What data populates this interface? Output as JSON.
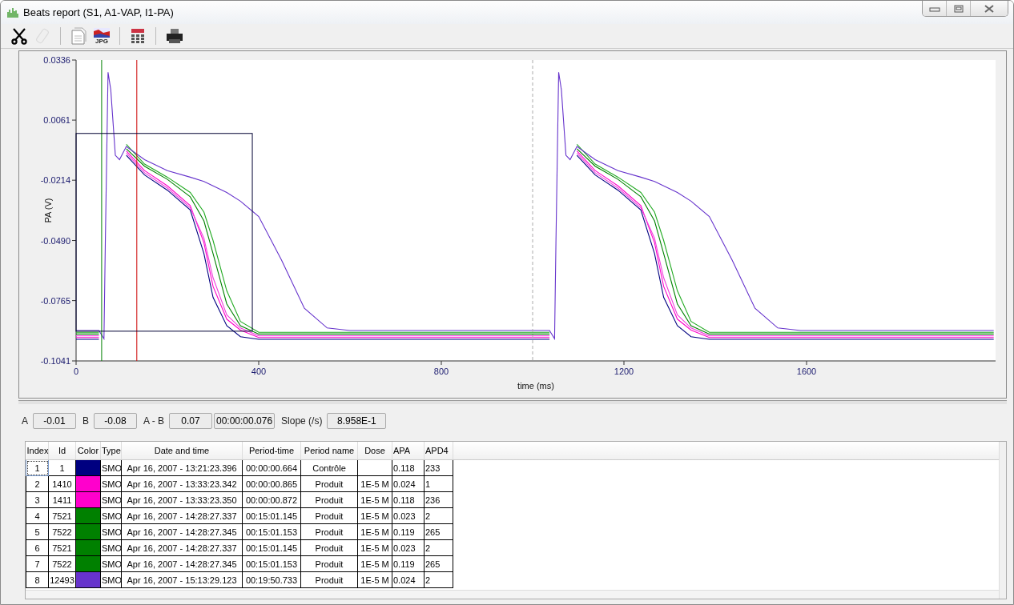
{
  "window": {
    "title": "Beats report (S1, A1-VAP, I1-PA)"
  },
  "toolbar": [
    {
      "kind": "scissors",
      "disabled": false
    },
    {
      "kind": "eraser",
      "disabled": true
    },
    {
      "kind": "separator"
    },
    {
      "kind": "document",
      "disabled": false
    },
    {
      "kind": "jpg",
      "label": "JPG",
      "disabled": false
    },
    {
      "kind": "separator"
    },
    {
      "kind": "table",
      "disabled": false
    },
    {
      "kind": "separator"
    },
    {
      "kind": "printer",
      "disabled": false
    }
  ],
  "chart": {
    "chart_data": {
      "type": "line",
      "xlabel": "time (ms)",
      "ylabel": "PA (V)",
      "xlim": [
        0,
        2014
      ],
      "ylim": [
        -0.1041,
        0.0336
      ],
      "xticks": [
        0,
        400,
        800,
        1200,
        1600
      ],
      "yticks": [
        {
          "value": 0.0336,
          "label": "0.0336"
        },
        {
          "value": 0.0061,
          "label": "0.0061"
        },
        {
          "value": -0.0214,
          "label": "-0.0214"
        },
        {
          "value": -0.049,
          "label": "-0.0490"
        },
        {
          "value": -0.0765,
          "label": "-0.0765"
        },
        {
          "value": -0.1041,
          "label": "-0.1041"
        }
      ],
      "x": [
        0,
        50,
        61,
        64,
        70,
        76,
        86,
        95,
        110,
        150,
        200,
        250,
        280,
        300,
        330,
        360,
        400,
        450,
        500,
        550,
        600,
        700,
        900,
        1000,
        1037,
        1048,
        1051,
        1057,
        1063,
        1073,
        1082,
        1097,
        1137,
        1187,
        1237,
        1267,
        1287,
        1317,
        1347,
        1387,
        1437,
        1487,
        1537,
        1587,
        1687,
        1900,
        2010
      ],
      "series": [
        {
          "color": "#000080",
          "values": [
            -0.0942,
            -0.0942,
            null,
            null,
            null,
            null,
            null,
            null,
            -0.01,
            -0.019,
            -0.026,
            -0.035,
            -0.055,
            -0.075,
            -0.088,
            -0.093,
            -0.0942,
            -0.0942,
            -0.0942,
            -0.0942,
            -0.0942,
            -0.0942,
            -0.0942,
            -0.0942,
            -0.0942,
            null,
            null,
            null,
            null,
            null,
            null,
            -0.01,
            -0.019,
            -0.026,
            -0.035,
            -0.055,
            -0.075,
            -0.088,
            -0.093,
            -0.0942,
            -0.0942,
            -0.0942,
            -0.0942,
            -0.0942,
            -0.0942,
            -0.0942,
            -0.0942
          ]
        },
        {
          "color": "#ff00cc",
          "values": [
            -0.0934,
            -0.0934,
            null,
            null,
            null,
            null,
            null,
            null,
            -0.008,
            -0.017,
            -0.024,
            -0.033,
            -0.05,
            -0.07,
            -0.085,
            -0.09,
            -0.0934,
            -0.0934,
            -0.0934,
            -0.0934,
            -0.0934,
            -0.0934,
            -0.0934,
            -0.0934,
            -0.0934,
            null,
            null,
            null,
            null,
            null,
            null,
            -0.008,
            -0.017,
            -0.024,
            -0.033,
            -0.05,
            -0.07,
            -0.085,
            -0.09,
            -0.0934,
            -0.0934,
            -0.0934,
            -0.0934,
            -0.0934,
            -0.0934,
            -0.0934,
            -0.0934
          ]
        },
        {
          "color": "#ee44dd",
          "values": [
            -0.0926,
            -0.0926,
            null,
            null,
            null,
            null,
            null,
            null,
            -0.009,
            -0.018,
            -0.025,
            -0.034,
            -0.048,
            -0.066,
            -0.083,
            -0.089,
            -0.0926,
            -0.0926,
            -0.0926,
            -0.0926,
            -0.0926,
            -0.0926,
            -0.0926,
            -0.0926,
            -0.0926,
            null,
            null,
            null,
            null,
            null,
            null,
            -0.009,
            -0.018,
            -0.025,
            -0.034,
            -0.048,
            -0.066,
            -0.083,
            -0.089,
            -0.0926,
            -0.0926,
            -0.0926,
            -0.0926,
            -0.0926,
            -0.0926,
            -0.0926,
            -0.0926
          ]
        },
        {
          "color": "#008000",
          "values": [
            -0.0918,
            -0.0918,
            null,
            null,
            null,
            null,
            null,
            null,
            -0.007,
            -0.015,
            -0.021,
            -0.029,
            -0.04,
            -0.055,
            -0.078,
            -0.088,
            -0.0918,
            -0.0918,
            -0.0918,
            -0.0918,
            -0.0918,
            -0.0918,
            -0.0918,
            -0.0918,
            -0.0918,
            null,
            null,
            null,
            null,
            null,
            null,
            -0.007,
            -0.015,
            -0.021,
            -0.029,
            -0.04,
            -0.055,
            -0.078,
            -0.088,
            -0.0918,
            -0.0918,
            -0.0918,
            -0.0918,
            -0.0918,
            -0.0918,
            -0.0918,
            -0.0918
          ]
        },
        {
          "color": "#22aa22",
          "values": [
            -0.091,
            -0.091,
            null,
            null,
            null,
            null,
            null,
            null,
            -0.005,
            -0.014,
            -0.02,
            -0.027,
            -0.036,
            -0.049,
            -0.072,
            -0.086,
            -0.091,
            -0.091,
            -0.091,
            -0.091,
            -0.091,
            -0.091,
            -0.091,
            -0.091,
            -0.091,
            null,
            null,
            null,
            null,
            null,
            null,
            -0.005,
            -0.014,
            -0.02,
            -0.027,
            -0.036,
            -0.049,
            -0.072,
            -0.086,
            -0.091,
            -0.091,
            -0.091,
            -0.091,
            -0.091,
            -0.091,
            -0.091,
            -0.091
          ]
        },
        {
          "color": "#6633cc",
          "values": [
            -0.0902,
            -0.0902,
            -0.094,
            -0.05,
            0.028,
            0.02,
            -0.01,
            -0.012,
            -0.006,
            -0.012,
            -0.017,
            -0.02,
            -0.022,
            -0.024,
            -0.027,
            -0.031,
            -0.038,
            -0.058,
            -0.08,
            -0.089,
            -0.0902,
            -0.0902,
            -0.0902,
            -0.0902,
            -0.0902,
            -0.094,
            -0.05,
            0.028,
            0.02,
            -0.01,
            -0.012,
            -0.006,
            -0.012,
            -0.017,
            -0.02,
            -0.022,
            -0.024,
            -0.027,
            -0.031,
            -0.038,
            -0.058,
            -0.08,
            -0.089,
            -0.0902,
            -0.0902,
            -0.0902,
            -0.0902
          ]
        }
      ],
      "ref_lines": [
        {
          "axis": "x",
          "value": 56,
          "color": "#008000"
        },
        {
          "axis": "x",
          "value": 133,
          "color": "#cc0000"
        }
      ]
    }
  },
  "readouts": [
    {
      "label": "A",
      "values": [
        "-0.01"
      ]
    },
    {
      "label": "B",
      "values": [
        "-0.08"
      ]
    },
    {
      "label": "A - B",
      "values": [
        "0.07",
        "00:00:00.076"
      ]
    },
    {
      "label": "Slope (/s)",
      "values": [
        "8.958E-1"
      ]
    }
  ],
  "table": {
    "columns": [
      "Index",
      "Id",
      "Color",
      "Type",
      "Date and time",
      "Period-time",
      "Period name",
      "Dose",
      "APA",
      "APD4"
    ],
    "rows": [
      {
        "index": "1",
        "id": "1",
        "color": "#000080",
        "type": "SMO",
        "date_time": "Apr 16, 2007 - 13:21:23.396",
        "period_time": "00:00:00.664",
        "period_name": "Contrôle",
        "dose": "",
        "apa": "0.118",
        "apd4": "233",
        "selected": true
      },
      {
        "index": "2",
        "id": "1410",
        "color": "#ff00cc",
        "type": "SMO",
        "date_time": "Apr 16, 2007 - 13:33:23.342",
        "period_time": "00:00:00.865",
        "period_name": "Produit",
        "dose": "1E-5 M",
        "apa": "0.024",
        "apd4": "1",
        "selected": false
      },
      {
        "index": "3",
        "id": "1411",
        "color": "#ff00cc",
        "type": "SMO",
        "date_time": "Apr 16, 2007 - 13:33:23.350",
        "period_time": "00:00:00.872",
        "period_name": "Produit",
        "dose": "1E-5 M",
        "apa": "0.118",
        "apd4": "236",
        "selected": false
      },
      {
        "index": "4",
        "id": "7521",
        "color": "#008000",
        "type": "SMO",
        "date_time": "Apr 16, 2007 - 14:28:27.337",
        "period_time": "00:15:01.145",
        "period_name": "Produit",
        "dose": "1E-5 M",
        "apa": "0.023",
        "apd4": "2",
        "selected": false
      },
      {
        "index": "5",
        "id": "7522",
        "color": "#008000",
        "type": "SMO",
        "date_time": "Apr 16, 2007 - 14:28:27.345",
        "period_time": "00:15:01.153",
        "period_name": "Produit",
        "dose": "1E-5 M",
        "apa": "0.119",
        "apd4": "265",
        "selected": false
      },
      {
        "index": "6",
        "id": "7521",
        "color": "#008000",
        "type": "SMO",
        "date_time": "Apr 16, 2007 - 14:28:27.337",
        "period_time": "00:15:01.145",
        "period_name": "Produit",
        "dose": "1E-5 M",
        "apa": "0.023",
        "apd4": "2",
        "selected": false
      },
      {
        "index": "7",
        "id": "7522",
        "color": "#008000",
        "type": "SMO",
        "date_time": "Apr 16, 2007 - 14:28:27.345",
        "period_time": "00:15:01.153",
        "period_name": "Produit",
        "dose": "1E-5 M",
        "apa": "0.119",
        "apd4": "265",
        "selected": false
      },
      {
        "index": "8",
        "id": "12493",
        "color": "#6633cc",
        "type": "SMO",
        "date_time": "Apr 16, 2007 - 15:13:29.123",
        "period_time": "00:19:50.733",
        "period_name": "Produit",
        "dose": "1E-5 M",
        "apa": "0.024",
        "apd4": "2",
        "selected": false
      }
    ]
  }
}
